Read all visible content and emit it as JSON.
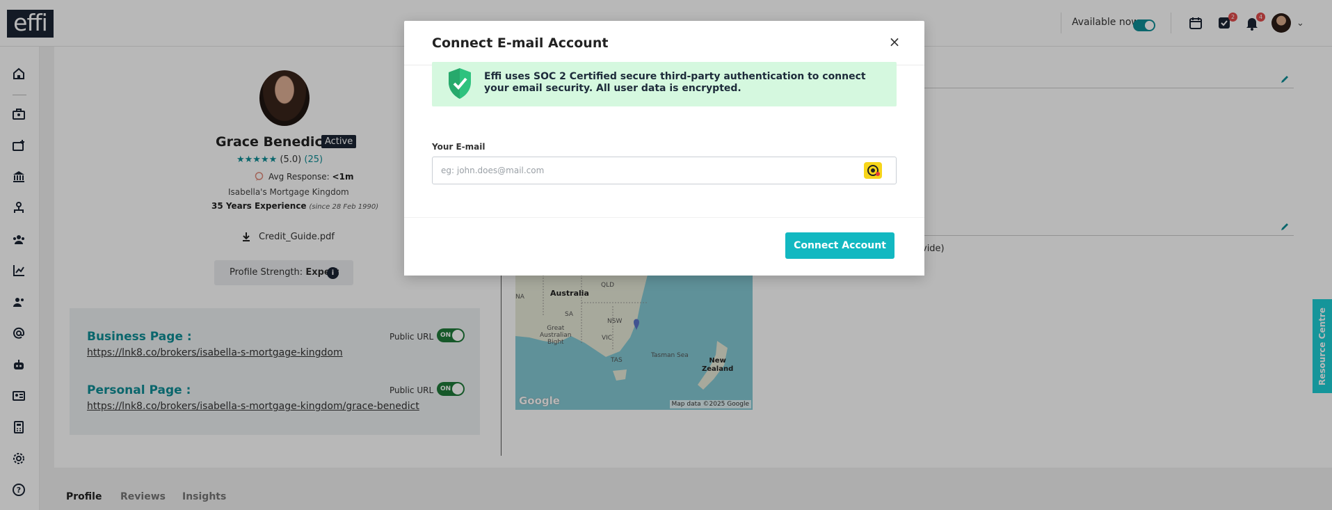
{
  "app": {
    "logo": "effi",
    "available_label": "Available now",
    "tasks_badge": "2",
    "notifications_badge": "4"
  },
  "profile": {
    "name": "Grace Benedict",
    "status": "Active",
    "stars": "★★★★★",
    "rating": "(5.0)",
    "reviews_count": "(25)",
    "avg_response_label": "Avg Response:",
    "avg_response_value": "<1m",
    "company": "Isabella's Mortgage Kingdom",
    "experience": "35 Years Experience",
    "experience_since": "(since 28 Feb 1990)",
    "file_name": "Credit_Guide.pdf",
    "strength_label": "Profile Strength:",
    "strength_value": "Expert",
    "info_icon": "i"
  },
  "links": {
    "business_title": "Business Page :",
    "business_url": "https://lnk8.co/brokers/isabella-s-mortgage-kingdom",
    "personal_title": "Personal Page :",
    "personal_url": "https://lnk8.co/brokers/isabella-s-mortgage-kingdom/grace-benedict",
    "public_url_label": "Public URL",
    "toggle_on": "ON"
  },
  "map": {
    "australia": "Australia",
    "qld": "QLD",
    "wa": "NA",
    "sa": "SA",
    "nsw": "NSW",
    "vic": "VIC",
    "tas": "TAS",
    "bight": "Great\nAustralian\nBight",
    "tasman": "Tasman Sea",
    "nz": "New\nZealand",
    "google": "Google",
    "attribution": "Map data ©2025 Google"
  },
  "right_panel": {
    "partial_text": "vide)"
  },
  "tabs": [
    "Profile",
    "Reviews",
    "Insights"
  ],
  "resource_centre": "Resource Centre",
  "modal": {
    "title": "Connect E-mail Account",
    "close": "×",
    "notice": "Effi uses SOC 2 Certified secure third-party authentication to connect your email security. All user data is encrypted.",
    "email_label": "Your E-mail",
    "email_placeholder": "eg: john.does@mail.com",
    "email_value": "",
    "connect_button": "Connect Account"
  },
  "colors": {
    "brand_dark": "#1b2434",
    "accent_teal": "#0e8e96",
    "button_cyan": "#12b8c1",
    "notice_green": "#d5f8df",
    "resource_cyan": "#1ecfd6"
  }
}
